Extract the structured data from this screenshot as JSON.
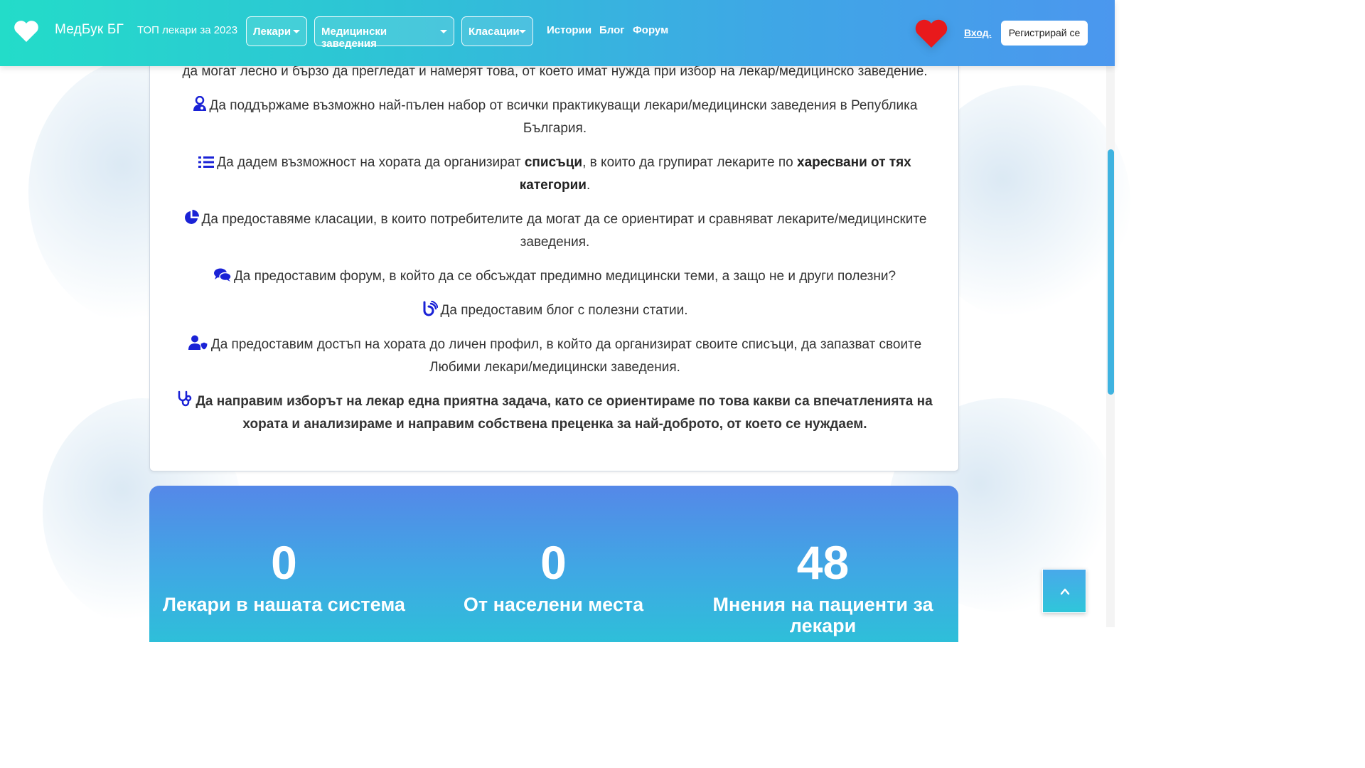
{
  "navbar": {
    "brand": "МедБук БГ",
    "top_doctors": "ТОП лекари за 2023",
    "dropdowns": [
      {
        "label": "Лекари"
      },
      {
        "label": "Медицински заведения"
      },
      {
        "label": "Класации"
      }
    ],
    "stories": "Истории",
    "blog": "Блог",
    "forum": "Форум",
    "login": "Вход.",
    "register": "Регистрирай се"
  },
  "content": {
    "line0": "да могат лесно и бързо да прегледат и намерят това, от което имат нужда при избор на лекар/медицинско заведение.",
    "item1": "Да поддържаме възможно най-пълен набор от всички практикуващи лекари/медицински заведения в Република България.",
    "item2_a": "Да дадем възможност на хората да организират ",
    "item2_b": "списъци",
    "item2_c": ", в които да групират лекарите по ",
    "item2_d": "харесвани от тях категории",
    "item2_e": ".",
    "item3": "Да предоставяме класации, в които потребителите да могат да се ориентират и сравняват лекарите/медицинските заведения.",
    "item4": "Да предоставим форум, в който да се обсъждат предимно медицински теми, а защо не и други полезни?",
    "item5": "Да предоставим блог с полезни статии.",
    "item6": "Да предоставим достъп на хората до личен профил, в който да организират своите списъци, да запазват своите Любими лекари/медицински заведения.",
    "item7": "Да направим изборът на лекар една приятна задача, като се ориентираме по това какви са впечатленията на хората и анализираме и направим собствена преценка за най-доброто, от което се нуждаем."
  },
  "stats": [
    {
      "value": "0",
      "label": "Лекари в нашата система"
    },
    {
      "value": "0",
      "label": "От населени места"
    },
    {
      "value": "48",
      "label": "Мнения на пациенти за лекари"
    }
  ],
  "icons": {
    "brand": "heart-icon",
    "favorites": "red-heart-icon",
    "item1": "user-doctor-icon",
    "item2": "list-icon",
    "item3": "pie-chart-icon",
    "item4": "comments-icon",
    "item5": "blog-icon",
    "item6": "user-shield-icon",
    "item7": "stethoscope-icon",
    "back_to_top": "chevron-up-icon"
  },
  "colors": {
    "icon_blue": "#1a22d6",
    "favorite_red": "#e8191c"
  }
}
